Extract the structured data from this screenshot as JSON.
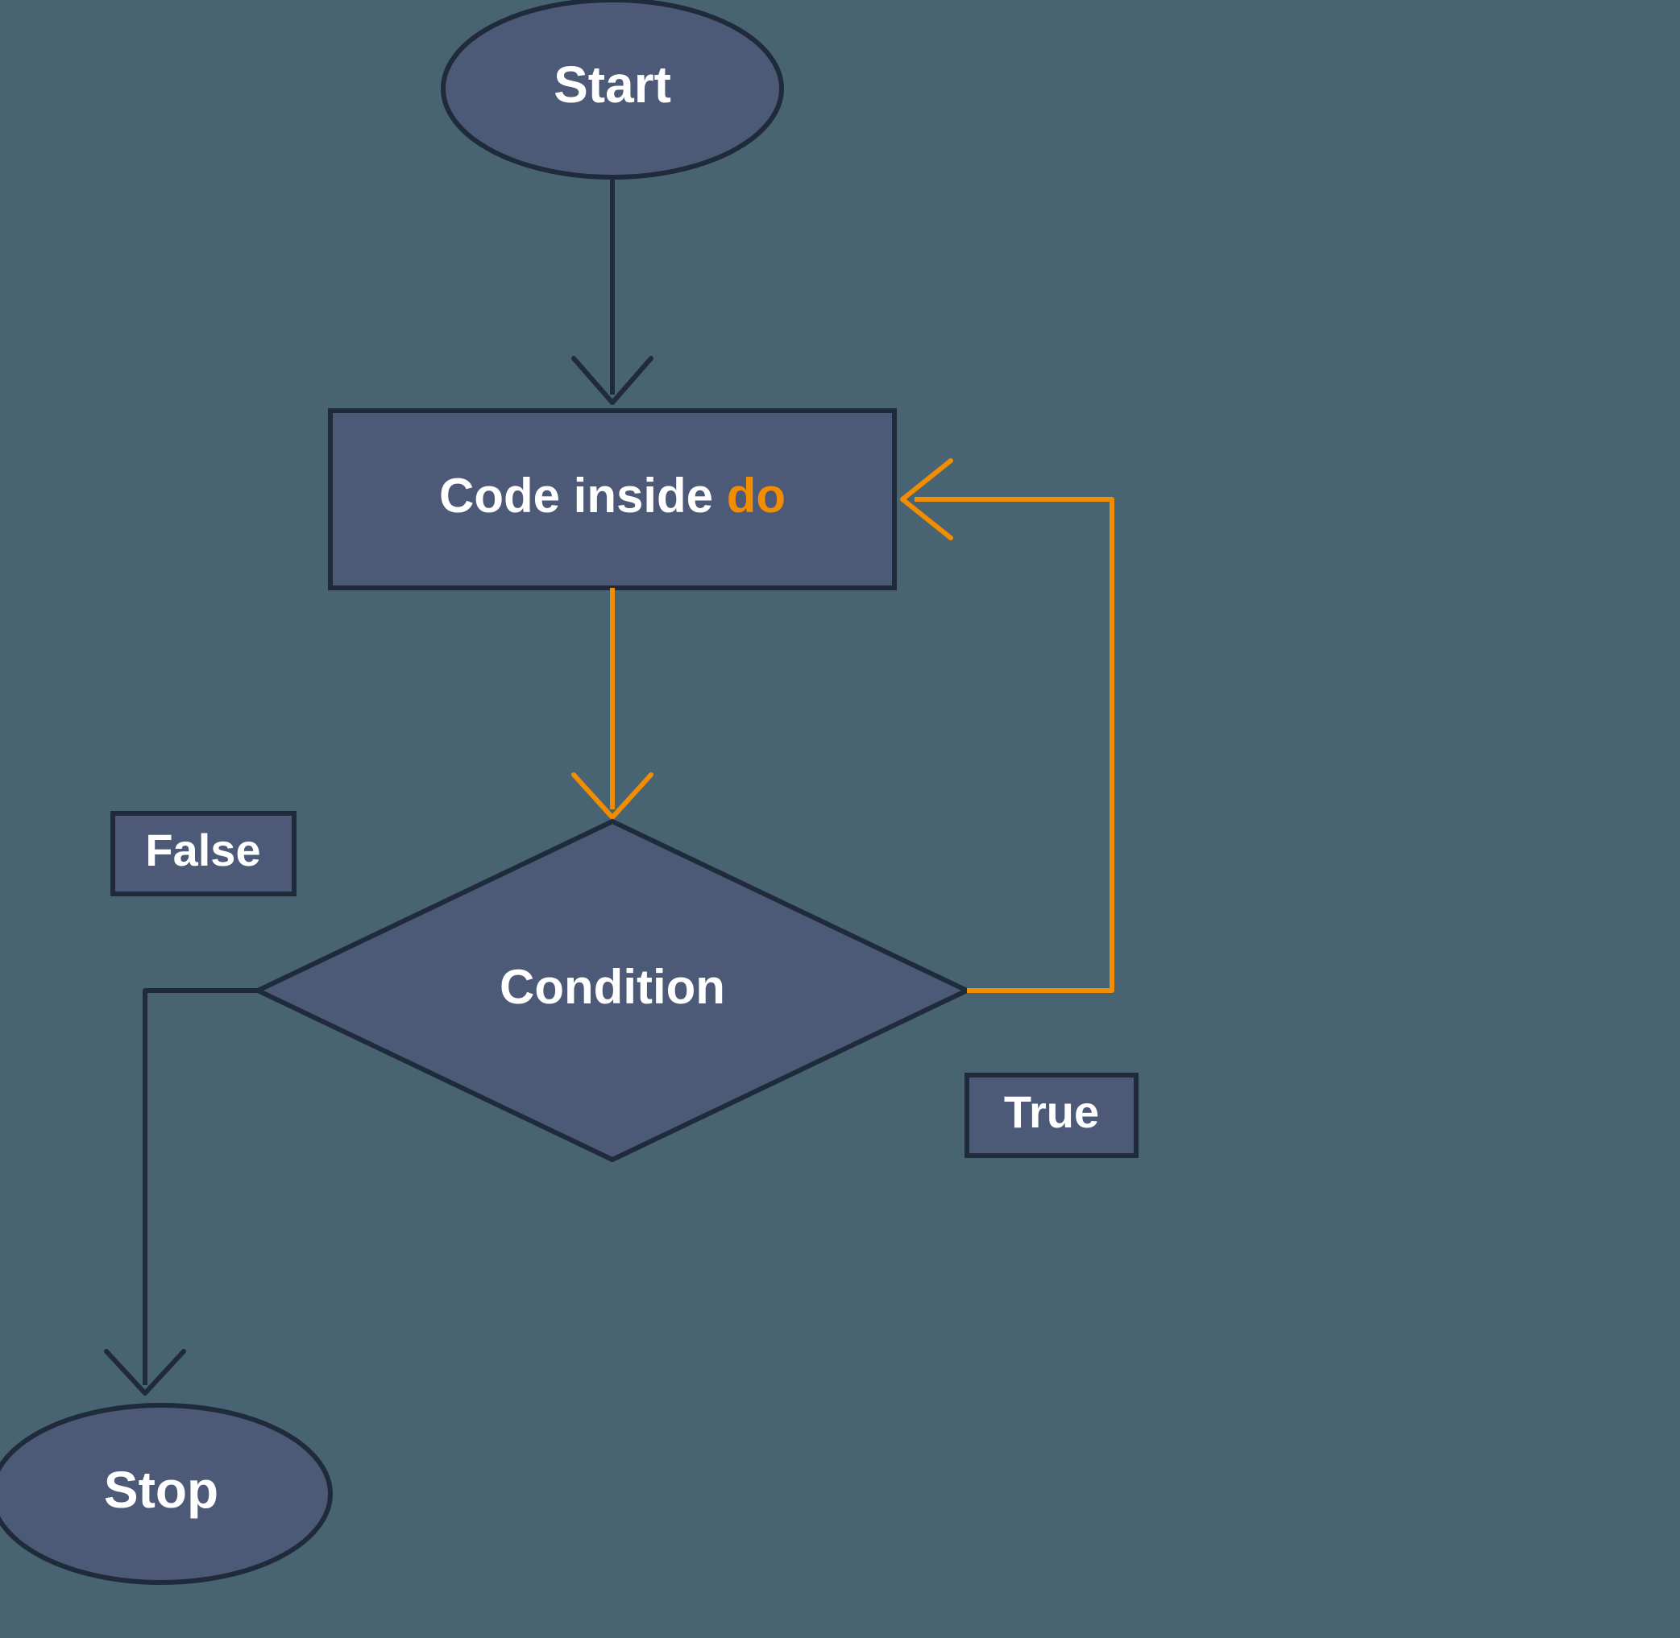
{
  "nodes": {
    "start": "Start",
    "process_prefix": "Code inside ",
    "process_keyword": "do",
    "condition": "Condition",
    "stop": "Stop"
  },
  "edges": {
    "true": "True",
    "false": "False"
  },
  "colors": {
    "background": "#486472",
    "shape_fill": "#4c5a77",
    "shape_stroke": "#1f2a3a",
    "loop_stroke": "#f28c00",
    "text": "#ffffff",
    "keyword": "#f28c00"
  }
}
